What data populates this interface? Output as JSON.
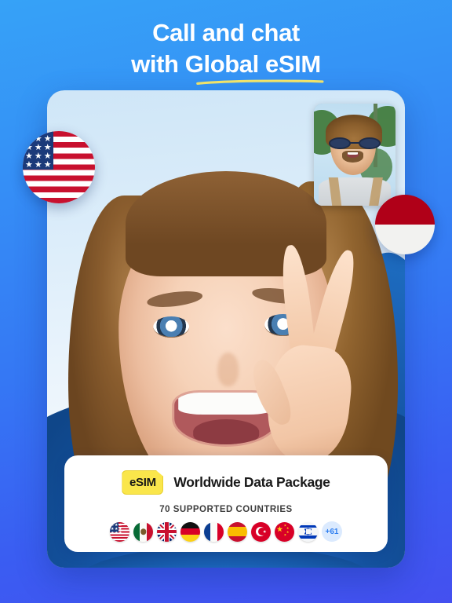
{
  "headline": {
    "line1": "Call and chat",
    "line2_prefix": "with ",
    "line2_highlight": "Global eSIM"
  },
  "colors": {
    "bg_top": "#36a2f7",
    "bg_bottom": "#4450f0",
    "underline": "#f7e96a",
    "esim_badge": "#fae64b",
    "plus_badge_bg": "#dbeafe",
    "plus_badge_text": "#2f7ff0"
  },
  "video_call": {
    "main_caller": "woman-peace-sign-laughing",
    "pip_caller": "man-sunglasses-laughing"
  },
  "floating_flags": [
    {
      "name": "united-states",
      "code": "US"
    },
    {
      "name": "indonesia",
      "code": "ID"
    }
  ],
  "panel": {
    "badge_label": "eSIM",
    "package_title": "Worldwide Data Package",
    "countries_label": "70 SUPPORTED COUNTRIES",
    "more_badge": "+61",
    "flags": [
      {
        "name": "united-states",
        "code": "US"
      },
      {
        "name": "mexico",
        "code": "MX"
      },
      {
        "name": "united-kingdom",
        "code": "GB"
      },
      {
        "name": "germany",
        "code": "DE"
      },
      {
        "name": "france",
        "code": "FR"
      },
      {
        "name": "spain",
        "code": "ES"
      },
      {
        "name": "turkey",
        "code": "TR"
      },
      {
        "name": "china",
        "code": "CN"
      },
      {
        "name": "israel",
        "code": "IL"
      }
    ]
  }
}
